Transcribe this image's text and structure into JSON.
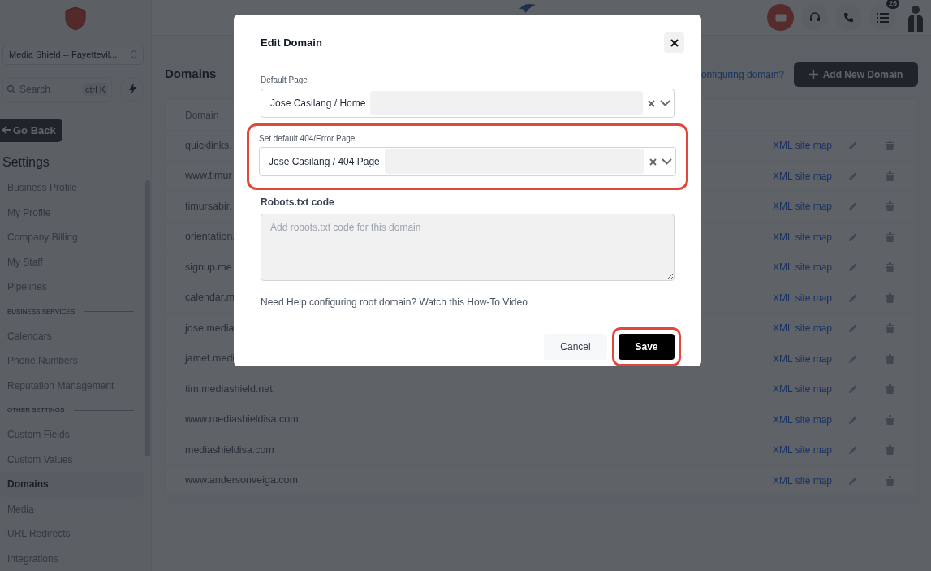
{
  "sidebar": {
    "account": "Media Shield -- Fayettevil...",
    "search": {
      "placeholder": "Search",
      "shortcut": "ctrl K"
    },
    "back_button": "Go Back",
    "heading": "Settings",
    "items": [
      {
        "kind": "item",
        "label": "Business Profile",
        "selected": false
      },
      {
        "kind": "item",
        "label": "My Profile",
        "selected": false
      },
      {
        "kind": "item",
        "label": "Company Billing",
        "selected": false
      },
      {
        "kind": "item",
        "label": "My Staff",
        "selected": false
      },
      {
        "kind": "item",
        "label": "Pipelines",
        "selected": false
      },
      {
        "kind": "section",
        "label": "BUSINESS SERVICES"
      },
      {
        "kind": "item",
        "label": "Calendars",
        "selected": false
      },
      {
        "kind": "item",
        "label": "Phone Numbers",
        "selected": false
      },
      {
        "kind": "item",
        "label": "Reputation Management",
        "selected": false
      },
      {
        "kind": "section",
        "label": "OTHER SETTINGS"
      },
      {
        "kind": "item",
        "label": "Custom Fields",
        "selected": false
      },
      {
        "kind": "item",
        "label": "Custom Values",
        "selected": false
      },
      {
        "kind": "item",
        "label": "Domains",
        "selected": true
      },
      {
        "kind": "item",
        "label": "Media",
        "selected": false
      },
      {
        "kind": "item",
        "label": "URL Redirects",
        "selected": false
      },
      {
        "kind": "item",
        "label": "Integrations",
        "selected": false
      }
    ]
  },
  "header": {
    "notification_count": "26"
  },
  "page": {
    "title": "Domains",
    "help_link": "onfiguring domain?",
    "add_button": "Add New Domain",
    "table": {
      "columns": [
        "Domain"
      ],
      "rows": [
        {
          "domain": "quicklinks.",
          "sitemap": "XML site map"
        },
        {
          "domain": "www.timur",
          "sitemap": "XML site map"
        },
        {
          "domain": "timursabir.",
          "sitemap": "XML site map"
        },
        {
          "domain": "orientation.",
          "sitemap": "XML site map"
        },
        {
          "domain": "signup.me",
          "sitemap": "XML site map"
        },
        {
          "domain": "calendar.m",
          "sitemap": "XML site map"
        },
        {
          "domain": "jose.media",
          "sitemap": "XML site map"
        },
        {
          "domain": "jamet.medi",
          "sitemap": "XML site map"
        },
        {
          "domain": "tim.mediashield.net",
          "sitemap": "XML site map"
        },
        {
          "domain": "www.mediashieldisa.com",
          "sitemap": "XML site map"
        },
        {
          "domain": "mediashieldisa.com",
          "sitemap": "XML site map"
        },
        {
          "domain": "www.andersonveiga.com",
          "sitemap": "XML site map"
        }
      ]
    }
  },
  "dialog": {
    "title": "Edit Domain",
    "fields": [
      {
        "kind": "select",
        "label": "Default Page",
        "value": "Jose Casilang / Home",
        "highlighted": false
      },
      {
        "kind": "select",
        "label": "Set default 404/Error Page",
        "value": "Jose Casilang / 404 Page",
        "highlighted": true
      },
      {
        "kind": "textarea",
        "label": "Robots.txt code",
        "placeholder": "Add robots.txt code for this domain"
      }
    ],
    "help_text": "Need Help configuring root domain? Watch this How-To Video",
    "buttons": [
      {
        "kind": "secondary",
        "label": "Cancel",
        "highlighted": false
      },
      {
        "kind": "primary",
        "label": "Save",
        "highlighted": true
      }
    ]
  }
}
